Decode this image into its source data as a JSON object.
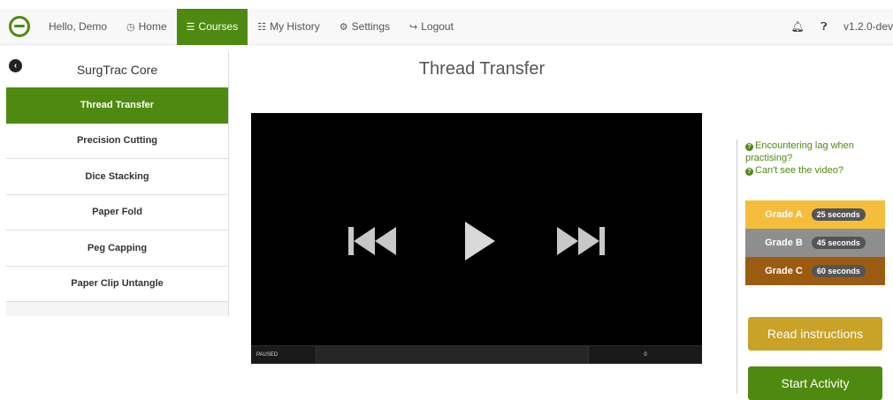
{
  "navbar": {
    "greeting": "Hello, Demo",
    "items": [
      {
        "label": "Home",
        "icon": "clock-icon",
        "glyph": "◷"
      },
      {
        "label": "Courses",
        "icon": "list-icon",
        "glyph": "☰",
        "active": true
      },
      {
        "label": "My History",
        "icon": "bar-chart-icon",
        "glyph": "☷"
      },
      {
        "label": "Settings",
        "icon": "gear-icon",
        "glyph": "⚙"
      },
      {
        "label": "Logout",
        "icon": "logout-icon",
        "glyph": "↪"
      }
    ],
    "version": "v1.2.0-dev"
  },
  "sidebar": {
    "title": "SurgTrac Core",
    "items": [
      {
        "label": "Thread Transfer",
        "active": true
      },
      {
        "label": "Precision Cutting"
      },
      {
        "label": "Dice Stacking"
      },
      {
        "label": "Paper Fold"
      },
      {
        "label": "Peg Capping"
      },
      {
        "label": "Paper Clip Untangle"
      }
    ]
  },
  "main": {
    "title": "Thread Transfer"
  },
  "player": {
    "state": "PAUSED",
    "time": "0"
  },
  "help": {
    "lag_link": "Encountering lag when practising?",
    "video_link": "Can't see the video?"
  },
  "grades": [
    {
      "label": "Grade A",
      "time": "25 seconds",
      "color": "#f5bd3c"
    },
    {
      "label": "Grade B",
      "time": "45 seconds",
      "color": "#8e8e8e"
    },
    {
      "label": "Grade C",
      "time": "60 seconds",
      "color": "#9b5c12"
    }
  ],
  "buttons": {
    "read_instructions": "Read instructions",
    "start_activity": "Start Activity"
  },
  "colors": {
    "brand_green": "#4f8a10",
    "read_button": "#c9a227",
    "start_button": "#4f8a10"
  }
}
